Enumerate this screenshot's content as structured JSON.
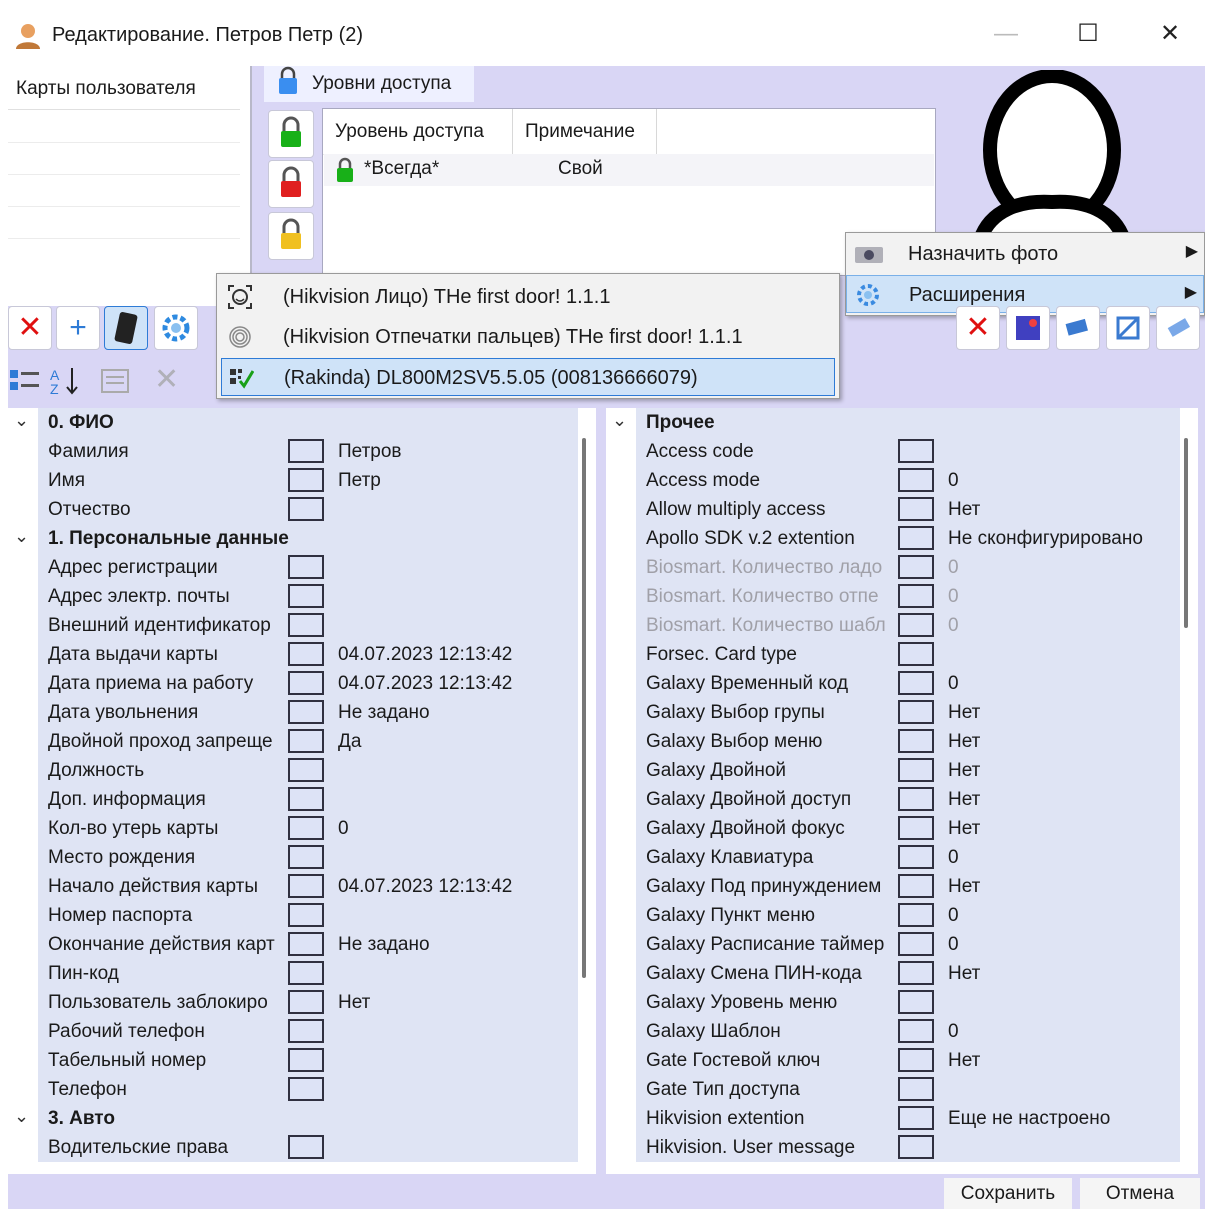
{
  "window": {
    "title": "Редактирование. Петров Петр (2)",
    "minimize_label": "—",
    "maximize_label": "☐",
    "close_label": "✕"
  },
  "cards": {
    "header": "Карты пользователя"
  },
  "access": {
    "tab_label": "Уровни доступа",
    "columns": [
      "Уровень доступа",
      "Примечание"
    ],
    "rows": [
      {
        "level": "*Всегда*",
        "note": "Свой"
      }
    ]
  },
  "context_menu": {
    "items": [
      {
        "label": "Назначить фото",
        "icon": "camera-icon"
      },
      {
        "label": "Расширения",
        "icon": "gear-icon"
      }
    ]
  },
  "extensions_menu": {
    "items": [
      {
        "label": "(Hikvision Лицо) THe first door! 1.1.1",
        "icon": "face-icon"
      },
      {
        "label": "(Hikvision Отпечатки пальцев) THe first door! 1.1.1",
        "icon": "fingerprint-icon"
      },
      {
        "label": "(Rakinda) DL800M2SV5.5.05 (008136666079)",
        "icon": "qr-check-icon"
      }
    ]
  },
  "left_grid": {
    "rows": [
      {
        "type": "cat",
        "name": "0. ФИО"
      },
      {
        "name": "Фамилия",
        "value": "Петров"
      },
      {
        "name": "Имя",
        "value": "Петр"
      },
      {
        "name": "Отчество",
        "value": ""
      },
      {
        "type": "cat",
        "name": "1. Персональные данные"
      },
      {
        "name": "Адрес регистрации",
        "value": ""
      },
      {
        "name": "Адрес электр. почты",
        "value": ""
      },
      {
        "name": "Внешний идентификатор",
        "value": ""
      },
      {
        "name": "Дата выдачи карты",
        "value": "04.07.2023 12:13:42"
      },
      {
        "name": "Дата приема на работу",
        "value": "04.07.2023 12:13:42"
      },
      {
        "name": "Дата увольнения",
        "value": "Не задано"
      },
      {
        "name": "Двойной проход запреще",
        "value": "Да"
      },
      {
        "name": "Должность",
        "value": ""
      },
      {
        "name": "Доп. информация",
        "value": ""
      },
      {
        "name": "Кол-во утерь карты",
        "value": "0"
      },
      {
        "name": "Место рождения",
        "value": ""
      },
      {
        "name": "Начало действия карты",
        "value": "04.07.2023 12:13:42"
      },
      {
        "name": "Номер паспорта",
        "value": ""
      },
      {
        "name": "Окончание действия карт",
        "value": "Не задано"
      },
      {
        "name": "Пин-код",
        "value": ""
      },
      {
        "name": "Пользователь заблокиро",
        "value": "Нет"
      },
      {
        "name": "Рабочий телефон",
        "value": ""
      },
      {
        "name": "Табельный номер",
        "value": ""
      },
      {
        "name": "Телефон",
        "value": ""
      },
      {
        "type": "cat",
        "name": "3. Авто"
      },
      {
        "name": "Водительские права",
        "value": ""
      }
    ]
  },
  "right_grid": {
    "rows": [
      {
        "type": "cat",
        "name": "Прочее"
      },
      {
        "name": "Access code",
        "value": ""
      },
      {
        "name": "Access mode",
        "value": "0"
      },
      {
        "name": "Allow multiply access",
        "value": "Нет"
      },
      {
        "name": "Apollo SDK v.2 extention",
        "value": "Не сконфигурировано"
      },
      {
        "name": "Biosmart. Количество ладо",
        "value": "0",
        "muted": true
      },
      {
        "name": "Biosmart. Количество отпе",
        "value": "0",
        "muted": true
      },
      {
        "name": "Biosmart. Количество шабл",
        "value": "0",
        "muted": true
      },
      {
        "name": "Forsec. Card type",
        "value": ""
      },
      {
        "name": "Galaxy Временный код",
        "value": "0"
      },
      {
        "name": "Galaxy Выбор групы",
        "value": "Нет"
      },
      {
        "name": "Galaxy Выбор меню",
        "value": "Нет"
      },
      {
        "name": "Galaxy Двойной",
        "value": "Нет"
      },
      {
        "name": "Galaxy Двойной доступ",
        "value": "Нет"
      },
      {
        "name": "Galaxy Двойной фокус",
        "value": "Нет"
      },
      {
        "name": "Galaxy Клавиатура",
        "value": "0"
      },
      {
        "name": "Galaxy Под принуждением",
        "value": "Нет"
      },
      {
        "name": "Galaxy Пункт меню",
        "value": "0"
      },
      {
        "name": "Galaxy Расписание таймер",
        "value": "0"
      },
      {
        "name": "Galaxy Смена ПИН-кода",
        "value": "Нет"
      },
      {
        "name": "Galaxy Уровень меню",
        "value": ""
      },
      {
        "name": "Galaxy Шаблон",
        "value": "0"
      },
      {
        "name": "Gate Гостевой ключ",
        "value": "Нет"
      },
      {
        "name": "Gate Тип доступа",
        "value": ""
      },
      {
        "name": "Hikvision extention",
        "value": "Еще не настроено"
      },
      {
        "name": "Hikvision. User message",
        "value": ""
      }
    ]
  },
  "buttons": {
    "save": "Сохранить",
    "cancel": "Отмена"
  },
  "colors": {
    "workspace": "#d9d6f5",
    "selection": "#cfe3f8",
    "delete_red": "#e01010",
    "accent_blue": "#2e7bd6"
  }
}
